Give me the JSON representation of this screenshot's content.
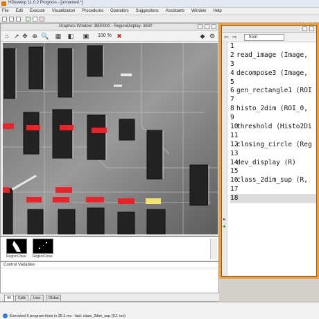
{
  "window": {
    "title": "HDevelop 11.0.2 Progress - [unnamed *]"
  },
  "menu": {
    "items": [
      "File",
      "Edit",
      "Execute",
      "Visualization",
      "Procedures",
      "Operators",
      "Suggestions",
      "Assistants",
      "Window",
      "Help"
    ]
  },
  "graphics_window": {
    "title": "Graphics Window: 3600000 - RegionDisplay: 3600"
  },
  "graphics_toolbar": {
    "zoom_value": "100 %"
  },
  "variable_window": {
    "thumbnails": [
      {
        "label": "RegionClose"
      },
      {
        "label": "RegionClose"
      }
    ]
  },
  "control_variables": {
    "label": "Control Variables"
  },
  "tabs": [
    "All",
    "Calls",
    "User",
    "Global"
  ],
  "program": {
    "from_select": "from",
    "lines": [
      {
        "num": "1",
        "text": ""
      },
      {
        "num": "2",
        "text": "read_image (Image,"
      },
      {
        "num": "3",
        "text": ""
      },
      {
        "num": "4",
        "text": "decompose3 (Image,"
      },
      {
        "num": "5",
        "text": ""
      },
      {
        "num": "6",
        "text": "gen_rectangle1 (ROI"
      },
      {
        "num": "7",
        "text": ""
      },
      {
        "num": "8",
        "text": "histo_2dim (ROI_0,"
      },
      {
        "num": "9",
        "text": ""
      },
      {
        "num": "10",
        "text": "threshold (Histo2Di"
      },
      {
        "num": "11",
        "text": ""
      },
      {
        "num": "12",
        "text": "closing_circle (Reg"
      },
      {
        "num": "13",
        "text": ""
      },
      {
        "num": "14",
        "text": "dev_display (R)"
      },
      {
        "num": "15",
        "text": ""
      },
      {
        "num": "16",
        "text": "class_2dim_sup (R,"
      },
      {
        "num": "17",
        "text": ""
      },
      {
        "num": "18",
        "text": ""
      }
    ],
    "current_line": "18"
  },
  "status": {
    "text": "Executed 9 program lines in 25.1 ms - last: class_2dim_sup (0.1 ms)"
  },
  "colors": {
    "accent_orange": "#f3a03a",
    "highlight_red": "#e8242a",
    "highlight_yellow": "#f2e36b"
  },
  "icons": [
    "app-icon",
    "open-icon",
    "save-icon",
    "run-icon",
    "zoom-icon",
    "pointer-icon",
    "lut-icon",
    "clear-icon",
    "home-icon",
    "back-icon",
    "forward-icon"
  ]
}
